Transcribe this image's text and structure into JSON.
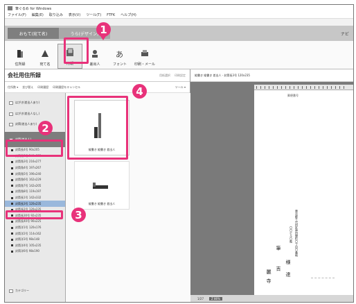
{
  "window": {
    "title": "筆ぐるめ for Windows"
  },
  "menu": [
    "ファイル(F)",
    "編集(E)",
    "取り込み",
    "表示(V)",
    "ツール(T)",
    "FTFK",
    "ヘルプ(H)"
  ],
  "tabs": {
    "omote": "おもて(宛て名)",
    "ura": "うら(デザイン)"
  },
  "navi": "ナビ",
  "toolbar": [
    {
      "label": "住所録",
      "icon": "address-book-icon"
    },
    {
      "label": "宛て名",
      "icon": "address-icon"
    },
    {
      "label": "用紙",
      "icon": "paper-icon"
    },
    {
      "label": "差出人",
      "icon": "sender-icon"
    },
    {
      "label": "フォント",
      "icon": "font-icon"
    },
    {
      "label": "印刷・メール",
      "icon": "print-icon"
    }
  ],
  "left": {
    "title": "会社用住所録",
    "header_actions": [
      "用紙選択",
      "印刷設定"
    ],
    "subbar": [
      "住所数 ▾",
      "並び替え",
      "印刷履歴",
      "印刷履歴をキャンセル"
    ],
    "tools_label": "ツール ▾"
  },
  "categories": [
    {
      "label": "はがき(差出人あり)"
    },
    {
      "label": "はがき(差出人なし)"
    },
    {
      "label": "封筒(差出人あり)"
    },
    {
      "label": "封筒(差出人)"
    }
  ],
  "envelopes": [
    "封筒長3号 120x235",
    "封筒長4号 90x205",
    "封筒角2号 240x332",
    "封筒角3号 216x277",
    "封筒角4号 197x267",
    "封筒角5号 190x240",
    "封筒角6号 162x229",
    "封筒角7号 142x205",
    "封筒角8号 119x197",
    "封筒長1号 142x332",
    "封筒長2号 120x235",
    "封筒長30号 92x235",
    "封筒長40号 90x225",
    "封筒洋1号 120x176",
    "封筒洋2号 114x162",
    "封筒洋3号 98x148",
    "封筒洋4号 105x235",
    "封筒洋6号 98x190"
  ],
  "category_bottom": "カテゴリー",
  "thumbs": [
    {
      "label": "縦書き 縦書き 差出人"
    },
    {
      "label": "縦書き 縦書き 差出人"
    }
  ],
  "right": {
    "header": "縦書き 縦書き 差出人 - 封筒長3号 120x235",
    "postal_label": "郵便番号",
    "address": "東京都千代田区神田錦町〇丁目〇番地",
    "building": "〇〇ビル〇階",
    "recipient_name": "筆 吉",
    "honorific": "様",
    "org": "麗寺",
    "org_suffix": "達",
    "status_left": "1/27",
    "zoom": "Z 86%"
  },
  "annotations": [
    "1",
    "2",
    "3",
    "4"
  ]
}
